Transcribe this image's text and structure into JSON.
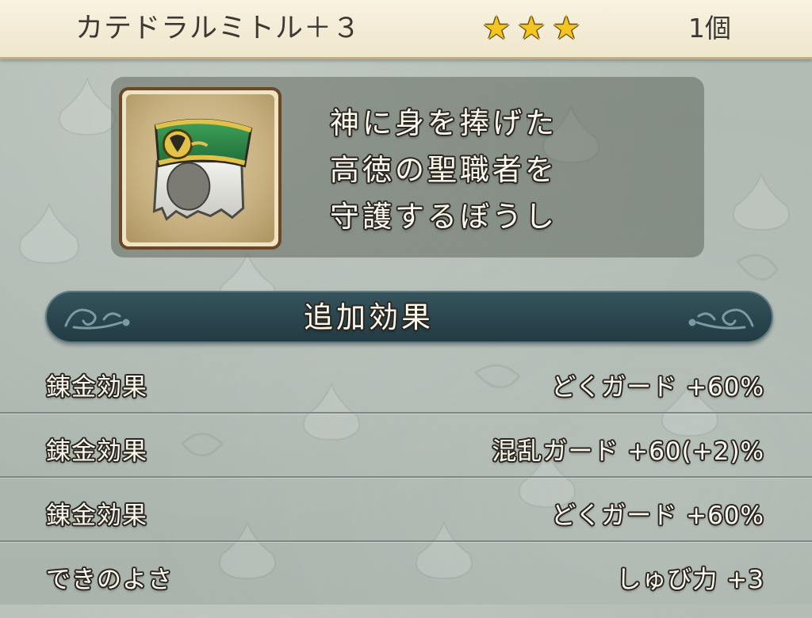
{
  "header": {
    "title": "カテドラルミトル＋３",
    "rarity_stars": 3,
    "star_icon": "star-icon",
    "count": "1個"
  },
  "item": {
    "icon": "mitre-hat-icon",
    "description": [
      "神に身を捧げた",
      "高徳の聖職者を",
      "守護するぼうし"
    ]
  },
  "section": {
    "title": "追加効果"
  },
  "effects": [
    {
      "label": "錬金効果",
      "value": "どくガード +60%"
    },
    {
      "label": "錬金効果",
      "value": "混乱ガード +60(+2)%"
    },
    {
      "label": "錬金効果",
      "value": "どくガード +60%"
    },
    {
      "label": "できのよさ",
      "value": "しゅび力 +3"
    }
  ],
  "colors": {
    "header_bg": "#f3ecd6",
    "section_bg": "#2d4850",
    "star": "#f4c41f",
    "background": "#aeb9b1"
  }
}
